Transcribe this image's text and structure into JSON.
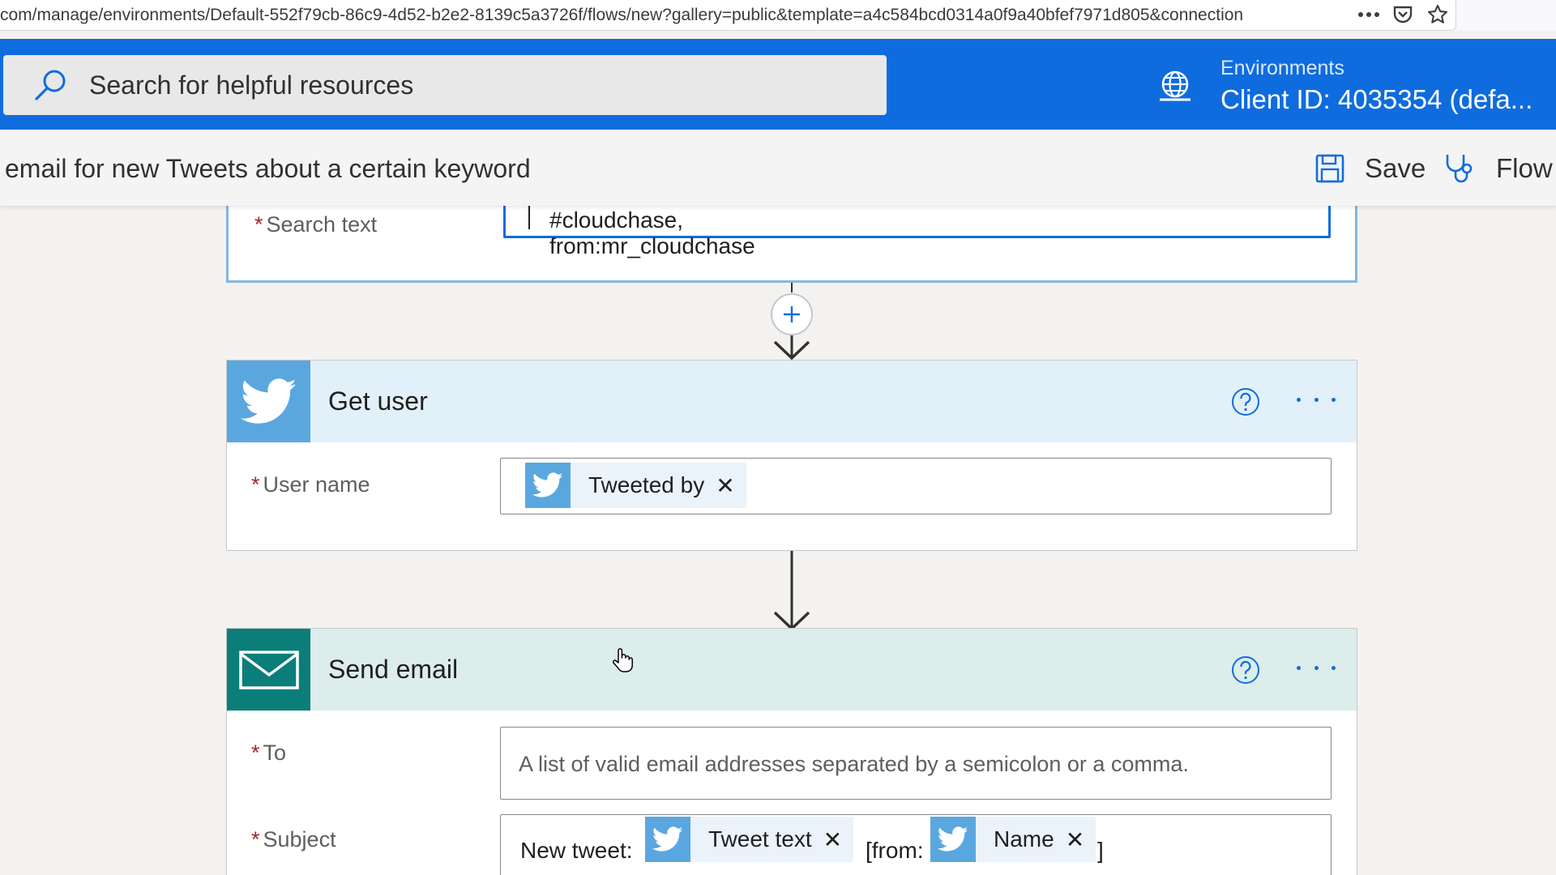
{
  "browser": {
    "url": "com/manage/environments/Default-552f79cb-86c9-4d52-b2e2-8139c5a3726f/flows/new?gallery=public&template=a4c584bcd0314a0f9a40bfef7971d805&connection",
    "icons": [
      "more-icon",
      "pocket-icon",
      "bookmark-star-icon"
    ]
  },
  "header": {
    "search_placeholder": "Search for helpful resources",
    "environment_label": "Environments",
    "environment_value": "Client ID: 4035354 (defa..."
  },
  "command_bar": {
    "flow_title": "email for new Tweets about a certain keyword",
    "save_label": "Save",
    "checker_label": "Flow c"
  },
  "trigger_card": {
    "search_text_label": "Search text",
    "search_text_value": "#cloudchase, from:mr_cloudchase"
  },
  "get_user_card": {
    "title": "Get user",
    "user_name_label": "User name",
    "user_name_token": "Tweeted by",
    "accent_color": "#5aa7df",
    "header_bg": "#e2f0fa"
  },
  "send_email_card": {
    "title": "Send email",
    "to_label": "To",
    "to_placeholder": "A list of valid email addresses separated by a semicolon or a comma.",
    "subject_label": "Subject",
    "subject_prefix": "New tweet:",
    "subject_token_1": "Tweet text",
    "subject_middle": "[from:",
    "subject_token_2": "Name",
    "subject_suffix": "]",
    "accent_color": "#0b7e7a",
    "header_bg": "#dcedeb"
  },
  "required_marker": "*",
  "token_remove": "✕",
  "colors": {
    "brand_blue": "#0f6cde",
    "twitter_blue": "#5aa7df"
  }
}
